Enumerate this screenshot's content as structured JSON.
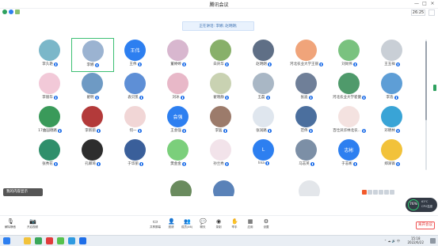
{
  "window": {
    "title": "腾讯会议",
    "minimize": "—",
    "maximize": "□",
    "close": "×"
  },
  "header": {
    "time": "26:25",
    "speaking": "正在讲话: 李娜; 赵明朗;"
  },
  "participants": [
    {
      "name": "李久艳",
      "avatar_text": "",
      "color": "#7bb7c9"
    },
    {
      "name": "李娜",
      "avatar_text": "",
      "color": "#9bb3d1",
      "active": true
    },
    {
      "name": "王伟",
      "avatar_text": "王伟",
      "color": "#2d7ff0"
    },
    {
      "name": "董婷婷",
      "avatar_text": "",
      "color": "#d8b7cf"
    },
    {
      "name": "白庆华",
      "avatar_text": "",
      "color": "#88b06a"
    },
    {
      "name": "赵明朗",
      "avatar_text": "",
      "color": "#5f6f86"
    },
    {
      "name": "河北农业大学王丽",
      "avatar_text": "",
      "color": "#f0a47a"
    },
    {
      "name": "刘尚伟",
      "avatar_text": "",
      "color": "#7ac27f"
    },
    {
      "name": "王玉祥",
      "avatar_text": "",
      "color": "#c9cfd6"
    },
    {
      "name": "李丽华",
      "avatar_text": "",
      "color": "#f2c9d8"
    },
    {
      "name": "翟明",
      "avatar_text": "",
      "color": "#6e9ac4"
    },
    {
      "name": "袁贝凯",
      "avatar_text": "",
      "color": "#5e8fd6"
    },
    {
      "name": "刘冰",
      "avatar_text": "",
      "color": "#e8b8c8"
    },
    {
      "name": "翟晓静",
      "avatar_text": "",
      "color": "#c9d2b2"
    },
    {
      "name": "王磊",
      "avatar_text": "",
      "color": "#a9b7c5"
    },
    {
      "name": "张迪",
      "avatar_text": "",
      "color": "#6f7f98"
    },
    {
      "name": "河北农业大学崔健",
      "avatar_text": "",
      "color": "#4f9a6b"
    },
    {
      "name": "李浩",
      "avatar_text": "",
      "color": "#5e9ed6"
    },
    {
      "name": "17曲园德路",
      "avatar_text": "",
      "color": "#3a9a5a"
    },
    {
      "name": "李新丽",
      "avatar_text": "",
      "color": "#b33a3a"
    },
    {
      "name": "何一",
      "avatar_text": "",
      "color": "#f1d6d6"
    },
    {
      "name": "王会强",
      "avatar_text": "会强",
      "color": "#2d7ff0"
    },
    {
      "name": "李猛",
      "avatar_text": "",
      "color": "#9c7b6b"
    },
    {
      "name": "张润路",
      "avatar_text": "",
      "color": "#dfe6ee"
    },
    {
      "name": "范伟",
      "avatar_text": "",
      "color": "#4b6f9e"
    },
    {
      "name": "百仕凤华林北农...",
      "avatar_text": "",
      "color": "#f4e2e0"
    },
    {
      "name": "邓明林",
      "avatar_text": "",
      "color": "#39a4d6"
    },
    {
      "name": "张秀花",
      "avatar_text": "",
      "color": "#2f8f6b"
    },
    {
      "name": "孔卿琦",
      "avatar_text": "",
      "color": "#2d2d2d"
    },
    {
      "name": "于华丽",
      "avatar_text": "",
      "color": "#3a5f9a"
    },
    {
      "name": "樊金金",
      "avatar_text": "",
      "color": "#7bcf7b"
    },
    {
      "name": "孙兰秀",
      "avatar_text": "",
      "color": "#f2e3ea"
    },
    {
      "name": "lina",
      "avatar_text": "L",
      "color": "#2d7ff0"
    },
    {
      "name": "马志英",
      "avatar_text": "",
      "color": "#7c8fa6"
    },
    {
      "name": "于志彬",
      "avatar_text": "志彬",
      "color": "#2d7ff0"
    },
    {
      "name": "郑泽锋",
      "avatar_text": "",
      "color": "#f2c23a"
    }
  ],
  "partial_row": [
    {
      "color": "#6a8b5e"
    },
    {
      "color": "#5a82b8"
    },
    {
      "color": "#e3e6ea"
    }
  ],
  "chat_toast": "我的内容显示",
  "speed": {
    "percent": "76%",
    "up": "63℃",
    "down": "CPU温度"
  },
  "toolbar": {
    "left": [
      {
        "label": "解除静音",
        "icon": "mic-muted-icon"
      },
      {
        "label": "开启视频",
        "icon": "camera-off-icon"
      }
    ],
    "center": [
      {
        "label": "共享屏幕",
        "icon": "screen-share-icon"
      },
      {
        "label": "邀请",
        "icon": "invite-icon"
      },
      {
        "label": "成员(46)",
        "icon": "members-icon"
      },
      {
        "label": "聊天",
        "icon": "chat-icon"
      },
      {
        "label": "录制",
        "icon": "record-icon"
      },
      {
        "label": "举手",
        "icon": "raise-hand-icon"
      },
      {
        "label": "应用",
        "icon": "apps-icon"
      },
      {
        "label": "设置",
        "icon": "settings-icon"
      }
    ],
    "leave": "离开会议"
  },
  "taskbar": {
    "time": "15:18",
    "date": "2022/6/22",
    "tray": "⌃ ☁ 🔊 中"
  }
}
